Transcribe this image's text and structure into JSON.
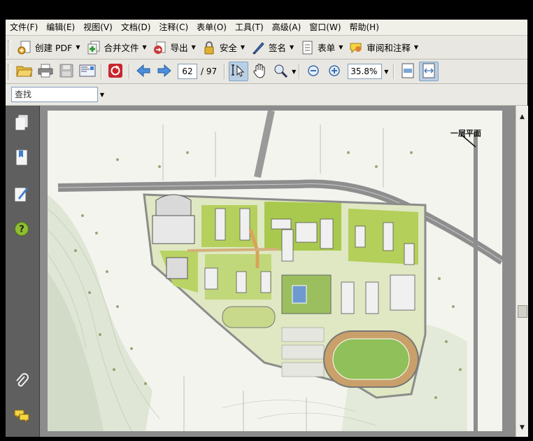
{
  "menu": [
    "文件(F)",
    "编辑(E)",
    "视图(V)",
    "文档(D)",
    "注释(C)",
    "表单(O)",
    "工具(T)",
    "高级(A)",
    "窗口(W)",
    "帮助(H)"
  ],
  "toolbar1": {
    "create_pdf": "创建 PDF",
    "combine_files": "合并文件",
    "export": "导出",
    "secure": "安全",
    "sign": "签名",
    "forms": "表单",
    "review_comment": "审阅和注释"
  },
  "toolbar2": {
    "current_page": "62",
    "total_pages": "/ 97",
    "zoom": "35.8%"
  },
  "find": {
    "value": "查找"
  },
  "document": {
    "page_heading": "一层平面"
  },
  "icons": [
    "open-folder-icon",
    "print-icon",
    "save-icon",
    "email-icon",
    "sync-icon",
    "previous-page-icon",
    "next-page-icon",
    "select-tool-icon",
    "hand-tool-icon",
    "zoom-tool-icon",
    "zoom-out-icon",
    "zoom-in-icon",
    "fit-page-icon",
    "fit-width-icon",
    "pages-icon",
    "bookmarks-icon",
    "signatures-icon",
    "help-icon",
    "attachments-icon",
    "comments-icon"
  ],
  "colors": {
    "accent": "#3d7fd0",
    "toolbar": "#e9e7e1",
    "nav": "#5f5f5f"
  }
}
